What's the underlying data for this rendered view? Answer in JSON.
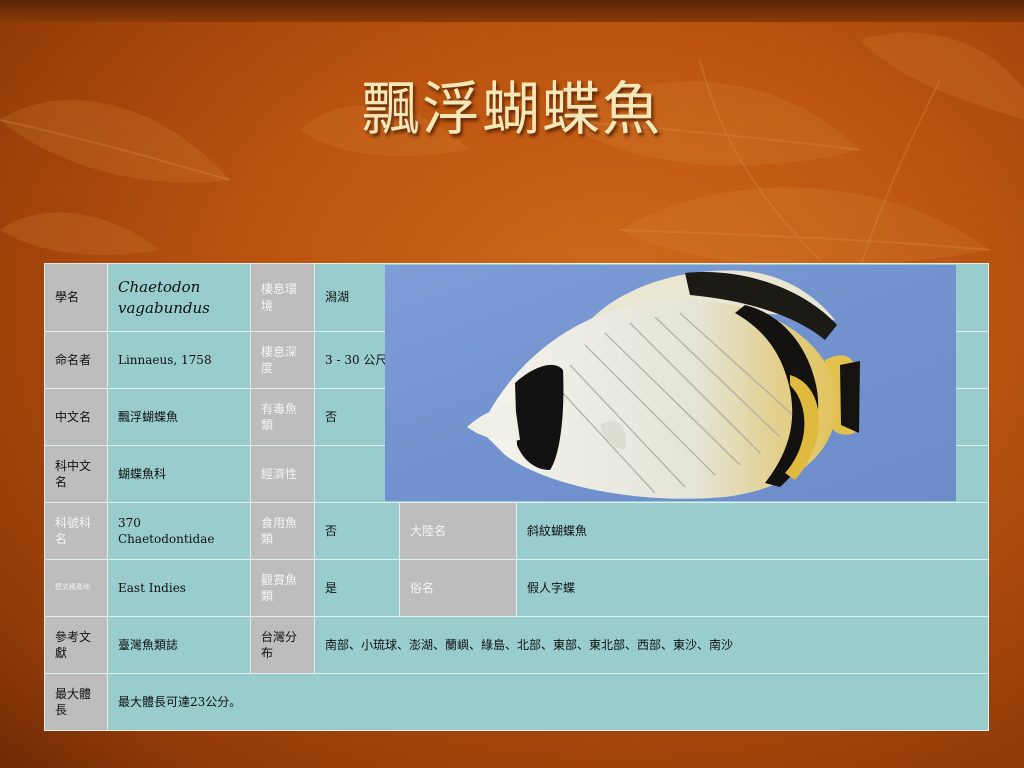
{
  "slide": {
    "title": "飄浮蝴蝶魚"
  },
  "table": {
    "scientific_name_label": "學名",
    "scientific_name": "Chaetodon vagabundus",
    "habitat_label": "棲息環境",
    "habitat": "潟湖",
    "author_label": "命名者",
    "author": "Linnaeus, 1758",
    "depth_label": "棲息深度",
    "depth": "3 - 30 公尺",
    "chinese_name_label": "中文名",
    "chinese_name": "飄浮蝴蝶魚",
    "venomous_label": "有毒魚類",
    "venomous": "否",
    "family_cn_label": "科中文名",
    "family_cn": "蝴蝶魚科",
    "economic_label": "經濟性",
    "economic": "",
    "family_no_label": "科號科名",
    "family_no": "370 Chaetodontidae",
    "edible_label": "食用魚類",
    "edible": "否",
    "mainland_label": "大陸名",
    "mainland": "斜紋蝴蝶魚",
    "type_locality_label": "模式種產地",
    "type_locality": "East Indies",
    "ornamental_label": "觀賞魚類",
    "ornamental": "是",
    "common_name_label": "俗名",
    "common_name": "假人字蝶",
    "reference_label": "參考文獻",
    "reference": "臺灣魚類誌",
    "distribution_label": "台灣分布",
    "distribution": "南部、小琉球、澎湖、蘭嶼、綠島、北部、東部、東北部、西部、東沙、南沙",
    "max_length_label": "最大體長",
    "max_length": "最大體長可達23公分。"
  },
  "colors": {
    "background": "#b8520f",
    "title_text": "#f6e7b8",
    "label_cell": "#bdbdbd",
    "value_cell": "#98cccd",
    "photo_background": "#7292cf"
  }
}
